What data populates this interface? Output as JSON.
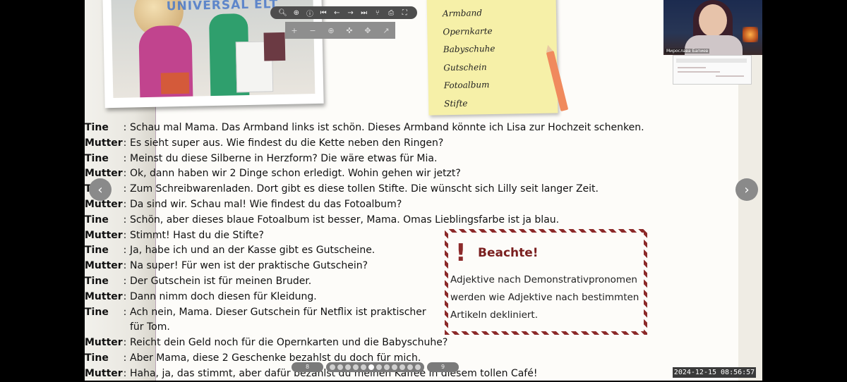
{
  "app": {
    "logo_text": "UNIVERSAL ELT"
  },
  "toolbar": {
    "icons": [
      "zoom-out-icon",
      "zoom-in-icon",
      "info-icon",
      "first-page-icon",
      "prev-page-icon",
      "next-page-icon",
      "last-page-icon",
      "share-icon",
      "print-icon",
      "fullscreen-icon"
    ]
  },
  "zoombar": {
    "icons": [
      "plus-icon",
      "minus-icon",
      "magnify-icon",
      "pan-icon",
      "move-icon",
      "select-icon"
    ]
  },
  "sticky_note": {
    "items": [
      "Armband",
      "Opernkarte",
      "Babyschuhe",
      "Gutschein",
      "Fotoalbum",
      "Stifte"
    ]
  },
  "dialogue": [
    {
      "speaker": "Tine",
      "text": "Schau mal Mama. Das Armband links ist schön.  Dieses Armband könnte ich Lisa zur Hochzeit schenken."
    },
    {
      "speaker": "Mutter",
      "text": "Es sieht super aus. Wie findest du die Kette neben den Ringen?"
    },
    {
      "speaker": "Tine",
      "text": "Meinst du diese Silberne in Herzform? Die wäre etwas für Mia."
    },
    {
      "speaker": "Mutter",
      "text": "Ok, dann haben wir 2 Dinge schon erledigt. Wohin gehen wir jetzt?"
    },
    {
      "speaker": "Tine",
      "text": "Zum Schreibwarenladen. Dort gibt es diese tollen Stifte. Die wünscht sich Lilly seit langer Zeit."
    },
    {
      "speaker": "Mutter",
      "text": "Da sind wir. Schau mal! Wie findest du das Fotoalbum?"
    },
    {
      "speaker": "Tine",
      "text": "Schön, aber dieses blaue Fotoalbum ist besser, Mama. Omas Lieblingsfarbe ist ja blau."
    },
    {
      "speaker": "Mutter",
      "text": "Stimmt! Hast du die Stifte?"
    },
    {
      "speaker": "Tine",
      "text": "Ja, habe ich und an der Kasse gibt es Gutscheine."
    },
    {
      "speaker": "Mutter",
      "text": "Na super! Für wen ist der praktische Gutschein?"
    },
    {
      "speaker": "Tine",
      "text": "Der Gutschein ist für meinen Bruder."
    },
    {
      "speaker": "Mutter",
      "text": "Dann nimm doch diesen für Kleidung."
    },
    {
      "speaker": "Tine",
      "text": "Ach nein, Mama. Dieser Gutschein für Netflix ist praktischer für Tom."
    },
    {
      "speaker": "Mutter",
      "text": "Reicht dein Geld noch für die Opernkarten und die Babyschuhe?"
    },
    {
      "speaker": "Tine",
      "text": "Aber Mama, diese 2 Geschenke bezahlst du doch für mich."
    },
    {
      "speaker": "Mutter",
      "text": "Haha, ja, das stimmt, aber dafür bezahlst du meinen Kaffee in diesem tollen Café!"
    }
  ],
  "separator": ":",
  "beachte": {
    "title": "Beachte!",
    "text": "Adjektive nach Demonstrativpronomen werden wie Adjektive nach bestimmten Artikeln dekliniert."
  },
  "pager": {
    "prev_page": "8",
    "next_page": "9",
    "dot_count": 12,
    "active_dot": 5
  },
  "webcam": {
    "name": "Мирослава Бапиев"
  },
  "timestamp": "2024-12-15 08:56:57",
  "colors": {
    "accent_red": "#8c2a2a",
    "sticky": "#f6f0a8",
    "page_border": "#b9a3b6"
  }
}
